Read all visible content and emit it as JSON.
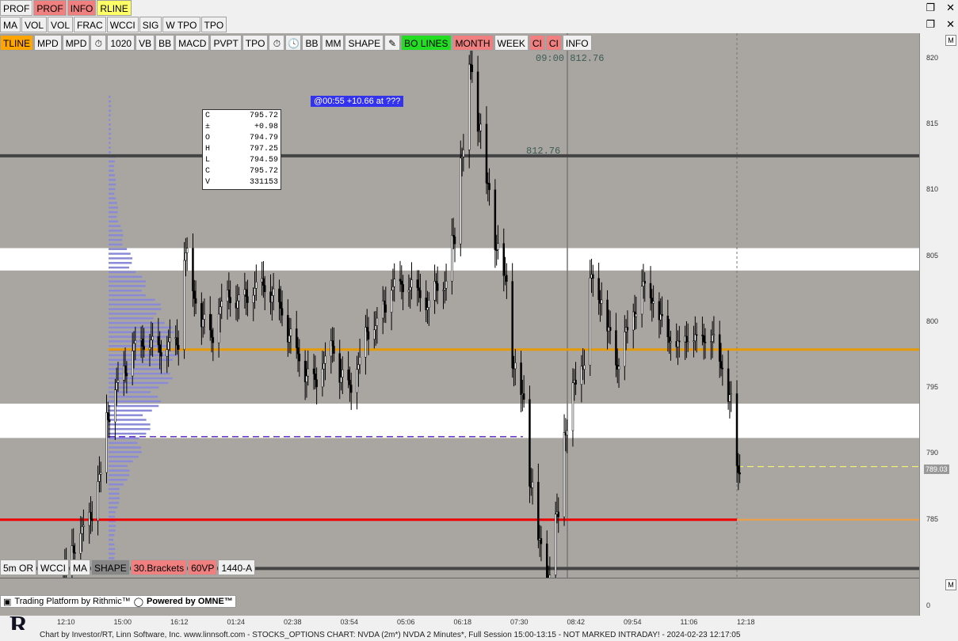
{
  "toolbar1": [
    "PROF",
    "PROF",
    "INFO",
    "RLINE"
  ],
  "toolbar2": [
    "MA",
    "VOL",
    "VOL",
    "FRAC",
    "WCCI",
    "SIG",
    "W TPO",
    "TPO"
  ],
  "toolbar3": {
    "items_a": [
      "TLINE",
      "MPD",
      "MPD"
    ],
    "item_b": "1020",
    "items_c": [
      "VB",
      "BB",
      "MACD",
      "PVPT",
      "TPO"
    ],
    "items_d": [
      "BB",
      "MM",
      "SHAPE"
    ],
    "items_e": [
      "BO LINES",
      "MONTH",
      "WEEK",
      "CI",
      "CI",
      "INFO"
    ]
  },
  "bottom_buttons": [
    "5m OR",
    "WCCI",
    "MA",
    "SHAPE",
    "30.Brackets",
    "60VP",
    "1440-A"
  ],
  "ohlc": [
    [
      "C",
      "795.72"
    ],
    [
      "±",
      "+0.98"
    ],
    [
      "O",
      "794.79"
    ],
    [
      "H",
      "797.25"
    ],
    [
      "L",
      "794.59"
    ],
    [
      "C",
      "795.72"
    ],
    [
      "V",
      "331153"
    ]
  ],
  "annotation": "@00:55  +10.66 at ???",
  "label_top": "09:00  812.76",
  "label_mid": "812.76",
  "price_tag": "789.03",
  "brand": "Trading Platform by Rithmic™",
  "brand2": "Powered by OMNE™",
  "status_text": "Chart by Investor/RT, Linn Software, Inc. www.linnsoft.com - STOCKS_OPTIONS CHART: NVDA (2m*) NVDA 2 Minutes*, Full Session 15:00-13:15 - NOT MARKED INTRADAY! - 2024-02-23 12:17:05",
  "sub_zero": "0",
  "m_label": "M",
  "chart_data": {
    "type": "candlestick",
    "y_ticks": [
      820,
      815,
      810,
      805,
      800,
      795,
      790,
      785
    ],
    "x_ticks": [
      "12:10",
      "15:00",
      "16:12",
      "01:24",
      "02:38",
      "03:54",
      "05:06",
      "06:18",
      "07:30",
      "08:42",
      "09:54",
      "11:06",
      "12:18"
    ],
    "ylim": [
      780.6,
      821.9
    ],
    "levels": {
      "dark_line_high": 812.6,
      "orange_line": 797.9,
      "red_line": 785.0,
      "dark_line_low": 781.3,
      "dashed_purple": 791.3,
      "last_price": 789.03
    },
    "white_bands": [
      [
        803.9,
        805.6
      ],
      [
        791.2,
        793.8
      ]
    ],
    "price_path": [
      [
        0,
        781
      ],
      [
        2,
        783
      ],
      [
        4,
        784
      ],
      [
        6,
        785.5
      ],
      [
        8,
        788
      ],
      [
        10,
        793
      ],
      [
        12,
        795
      ],
      [
        14,
        796.5
      ],
      [
        16,
        798
      ],
      [
        18,
        798.5
      ],
      [
        20,
        798.3
      ],
      [
        22,
        798
      ],
      [
        24,
        798.2
      ],
      [
        26,
        798.5
      ],
      [
        28,
        805
      ],
      [
        30,
        802
      ],
      [
        32,
        800
      ],
      [
        34,
        799
      ],
      [
        36,
        801
      ],
      [
        38,
        802
      ],
      [
        40,
        801.5
      ],
      [
        42,
        802
      ],
      [
        44,
        802.5
      ],
      [
        46,
        802.8
      ],
      [
        48,
        802
      ],
      [
        50,
        801
      ],
      [
        52,
        799
      ],
      [
        54,
        797.5
      ],
      [
        56,
        796
      ],
      [
        58,
        795.5
      ],
      [
        60,
        797
      ],
      [
        62,
        798
      ],
      [
        64,
        796
      ],
      [
        66,
        795
      ],
      [
        68,
        797
      ],
      [
        70,
        799
      ],
      [
        72,
        800
      ],
      [
        74,
        801
      ],
      [
        76,
        803
      ],
      [
        78,
        802.5
      ],
      [
        80,
        803
      ],
      [
        82,
        802
      ],
      [
        84,
        801.5
      ],
      [
        86,
        802.5
      ],
      [
        88,
        803
      ],
      [
        90,
        806
      ],
      [
        92,
        813
      ],
      [
        94,
        819
      ],
      [
        96,
        815
      ],
      [
        98,
        810
      ],
      [
        100,
        806
      ],
      [
        102,
        803
      ],
      [
        104,
        797
      ],
      [
        106,
        794
      ],
      [
        108,
        788
      ],
      [
        110,
        783
      ],
      [
        112,
        781
      ],
      [
        114,
        785
      ],
      [
        116,
        792
      ],
      [
        118,
        795
      ],
      [
        120,
        797
      ],
      [
        122,
        803
      ],
      [
        124,
        802
      ],
      [
        126,
        799
      ],
      [
        128,
        797
      ],
      [
        130,
        799
      ],
      [
        132,
        801
      ],
      [
        134,
        802.5
      ],
      [
        136,
        802
      ],
      [
        138,
        800
      ],
      [
        140,
        799
      ],
      [
        142,
        798
      ],
      [
        144,
        799
      ],
      [
        146,
        798.5
      ],
      [
        148,
        799
      ],
      [
        150,
        798.5
      ],
      [
        152,
        797
      ],
      [
        154,
        794
      ],
      [
        156,
        789.03
      ]
    ]
  }
}
